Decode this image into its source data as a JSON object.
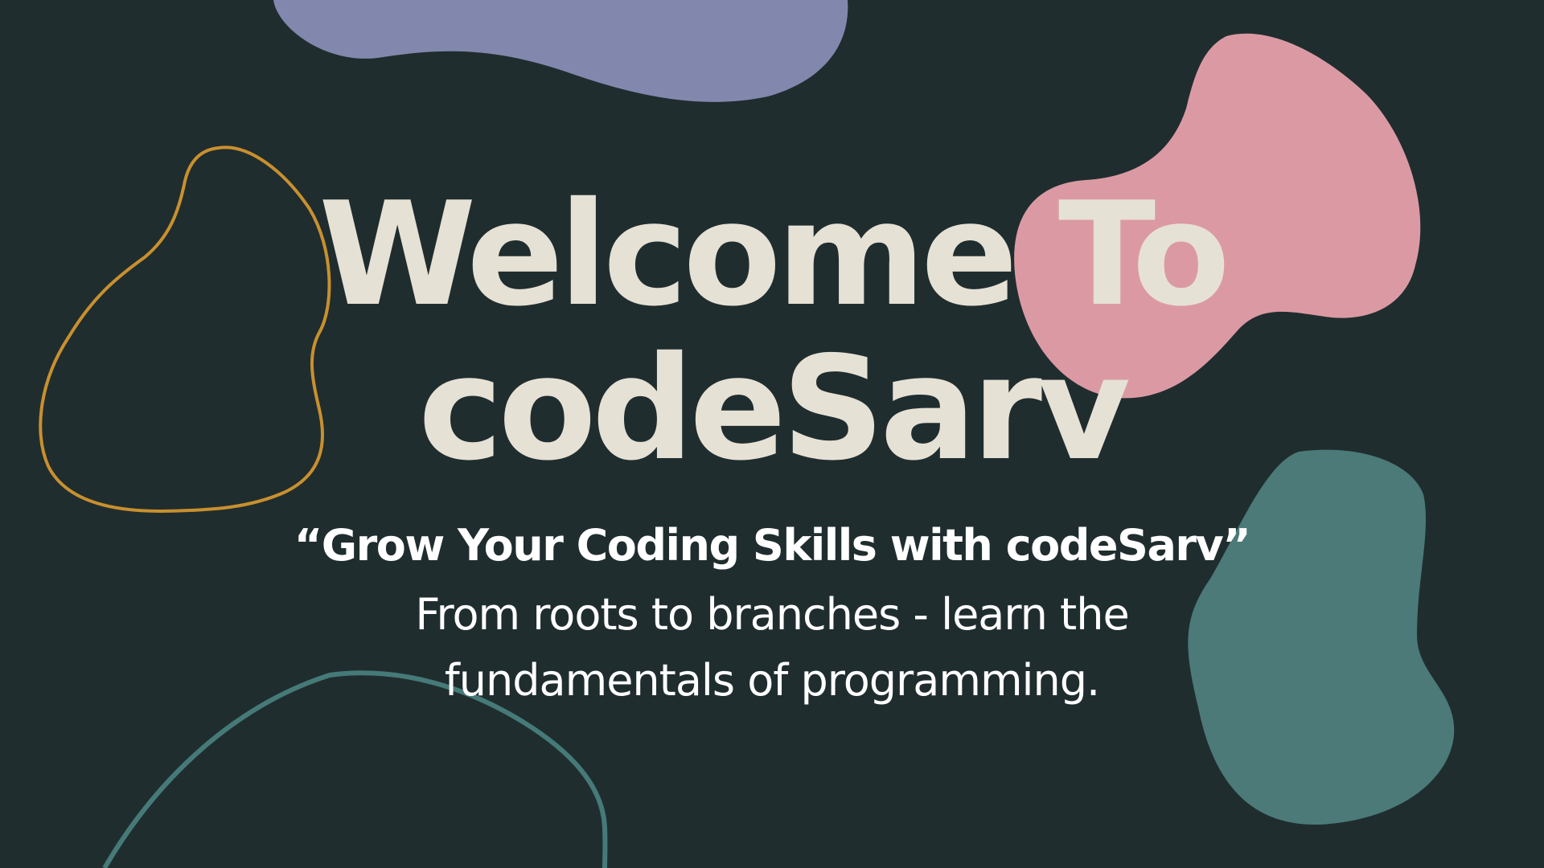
{
  "hero": {
    "title_line1": "Welcome To",
    "title_line2": "codeSarv",
    "tagline": "“Grow Your Coding Skills with codeSarv”",
    "description_line1": "From roots to branches - learn the",
    "description_line2": "fundamentals of programming."
  },
  "colors": {
    "background": "#202d2f",
    "title_text": "#e6e1d5",
    "body_text": "#ffffff",
    "blob_lavender": "#8288ad",
    "blob_pink": "#db9aa3",
    "blob_teal": "#4b7a78",
    "outline_gold": "#c8902e",
    "outline_teal": "#457a78"
  }
}
